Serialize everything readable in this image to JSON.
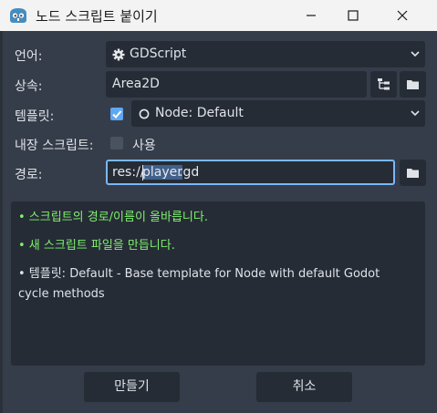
{
  "window": {
    "title": "노드 스크립트 붙이기",
    "app_icon": "godot-icon",
    "controls": [
      "minimize-icon",
      "maximize-icon",
      "close-icon"
    ]
  },
  "form": {
    "language": {
      "label": "언어:",
      "value": "GDScript",
      "icon": "gear-icon"
    },
    "inherits": {
      "label": "상속:",
      "value": "Area2D"
    },
    "template": {
      "label": "템플릿:",
      "enabled": true,
      "value": "Node: Default",
      "icon": "circle-icon"
    },
    "builtin": {
      "label": "내장 스크립트:",
      "checked": false,
      "option_label": "사용"
    },
    "path": {
      "label": "경로:",
      "prefix": "res://",
      "selected": "player",
      "suffix": ".gd"
    }
  },
  "messages": [
    {
      "type": "ok",
      "text": "• 스크립트의 경로/이름이 올바릅니다."
    },
    {
      "type": "ok",
      "text": "• 새 스크립트 파일을 만듭니다."
    },
    {
      "type": "info",
      "text": "• 템플릿: Default - Base template for Node with default Godot cycle methods"
    }
  ],
  "buttons": {
    "create": "만들기",
    "cancel": "취소"
  },
  "colors": {
    "background": "#363d4a",
    "field": "#262c36",
    "accent": "#5fa8f0",
    "focus_border": "#7ab7f7",
    "success_text": "#7ff06e",
    "titlebar": "#f3f3f3"
  }
}
